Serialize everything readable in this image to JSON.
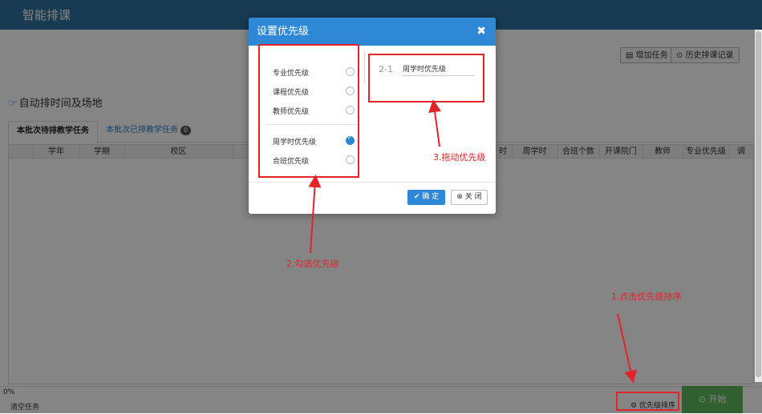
{
  "app": {
    "title": "智能排课"
  },
  "toolbar": {
    "add_task": "增加任务",
    "history": "历史排课记录"
  },
  "section": {
    "title": "自动排时间及场地"
  },
  "tabs": [
    {
      "label": "本批次待排教学任务"
    },
    {
      "label": "本批次已排教学任务",
      "badge": "0"
    }
  ],
  "table": {
    "columns": [
      "学年",
      "学期",
      "校区",
      "时",
      "周学时",
      "合班个数",
      "开课院门",
      "教师",
      "专业优先级",
      "调"
    ]
  },
  "footer": {
    "progress": "0%",
    "clear_task": "清空任务",
    "priority_sort": "优先级排序",
    "start": "开始"
  },
  "modal": {
    "title": "设置优先级",
    "close_symbol": "✖",
    "options": [
      {
        "label": "专业优先级",
        "checked": false
      },
      {
        "label": "课程优先级",
        "checked": false
      },
      {
        "label": "教师优先级",
        "checked": false
      },
      {
        "label": "周学时优先级",
        "checked": true
      },
      {
        "label": "合班优先级",
        "checked": false
      }
    ],
    "selected": {
      "index": "2-1",
      "label": "周学时优先级"
    },
    "ok": "确 定",
    "close": "关 闭"
  },
  "annotations": {
    "step1": "1.点击优先级排序",
    "step2": "2.勾选优先级",
    "step3": "3.拖动优先级"
  },
  "colors": {
    "accent": "#2f88d6",
    "header": "#2f6f9f",
    "start": "#5cb85c",
    "annotation": "#e2242b"
  }
}
